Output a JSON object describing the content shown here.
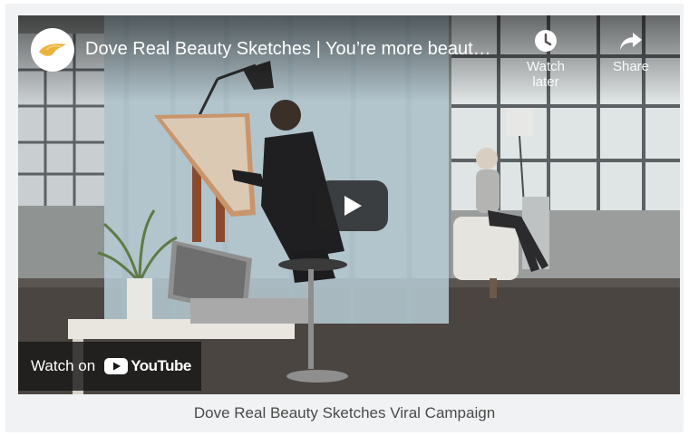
{
  "video": {
    "title": "Dove Real Beauty Sketches | You’re more beaut…",
    "channel_logo_icon": "dove-bird-icon",
    "actions": {
      "watch_later_label": "Watch later",
      "share_label": "Share"
    },
    "play_icon": "play-icon",
    "watch_on": {
      "prefix": "Watch on",
      "brand": "YouTube"
    }
  },
  "caption": "Dove Real Beauty Sketches Viral Campaign",
  "colors": {
    "card_bg": "#f1f2f3",
    "dove_gold": "#e9b43b",
    "youtube_red": "#ff0000",
    "caption_text": "#4a4a4a"
  }
}
